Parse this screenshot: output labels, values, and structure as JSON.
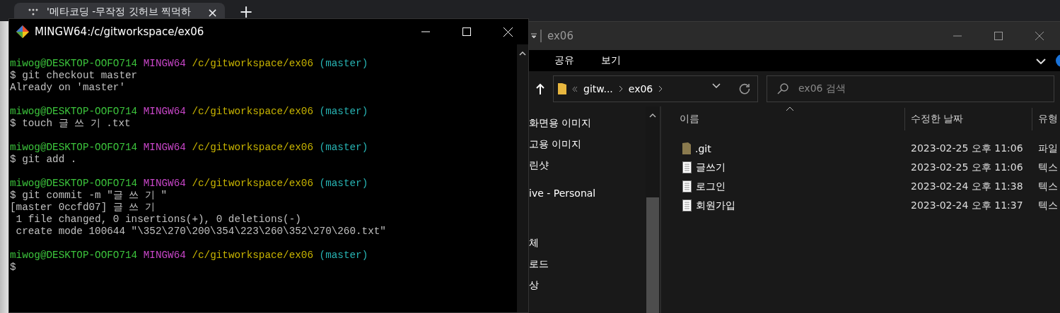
{
  "browser": {
    "tab_title": "'메타코딩 -무작정 깃허브 찍먹하",
    "tab_close": "×",
    "new_tab": "+"
  },
  "explorer": {
    "title": "ex06",
    "ribbon_tabs": [
      "공유",
      "보기"
    ],
    "breadcrumb": [
      "gitw...",
      "ex06"
    ],
    "search": {
      "placeholder": "ex06 검색"
    },
    "nav_items": [
      "화면용 이미지",
      "고용 이미지",
      "린샷",
      "ive - Personal",
      "체",
      "로드",
      "상"
    ],
    "columns": [
      "이름",
      "수정한 날짜",
      "유형"
    ],
    "files": [
      {
        "kind": "folder",
        "name": ".git",
        "modified": "2023-02-25 오후 11:06",
        "type": "파일"
      },
      {
        "kind": "text",
        "name": "글쓰기",
        "modified": "2023-02-25 오후 11:06",
        "type": "텍스"
      },
      {
        "kind": "text",
        "name": "로그인",
        "modified": "2023-02-24 오후 11:38",
        "type": "텍스"
      },
      {
        "kind": "text",
        "name": "회원가입",
        "modified": "2023-02-24 오후 11:37",
        "type": "텍스"
      }
    ]
  },
  "terminal": {
    "title": "MINGW64:/c/gitworkspace/ex06",
    "lines": [
      {
        "kind": "prompt",
        "user": "miwog@DESKTOP-OOFO714",
        "system": "MINGW64",
        "path": "/c/gitworkspace/ex06",
        "branch": "(master)"
      },
      {
        "kind": "output",
        "text": "$ git checkout master"
      },
      {
        "kind": "output",
        "text": "Already on 'master'"
      },
      {
        "kind": "blank"
      },
      {
        "kind": "prompt",
        "user": "miwog@DESKTOP-OOFO714",
        "system": "MINGW64",
        "path": "/c/gitworkspace/ex06",
        "branch": "(master)"
      },
      {
        "kind": "output",
        "text": "$ touch 글 쓰 기 .txt"
      },
      {
        "kind": "blank"
      },
      {
        "kind": "prompt",
        "user": "miwog@DESKTOP-OOFO714",
        "system": "MINGW64",
        "path": "/c/gitworkspace/ex06",
        "branch": "(master)"
      },
      {
        "kind": "output",
        "text": "$ git add ."
      },
      {
        "kind": "blank"
      },
      {
        "kind": "prompt",
        "user": "miwog@DESKTOP-OOFO714",
        "system": "MINGW64",
        "path": "/c/gitworkspace/ex06",
        "branch": "(master)"
      },
      {
        "kind": "output",
        "text": "$ git commit -m \"글 쓰 기 \""
      },
      {
        "kind": "output",
        "text": "[master 0ccfd07] 글 쓰 기"
      },
      {
        "kind": "output",
        "text": " 1 file changed, 0 insertions(+), 0 deletions(-)"
      },
      {
        "kind": "output",
        "text": " create mode 100644 \"\\352\\270\\200\\354\\223\\260\\352\\270\\260.txt\""
      },
      {
        "kind": "blank"
      },
      {
        "kind": "prompt",
        "user": "miwog@DESKTOP-OOFO714",
        "system": "MINGW64",
        "path": "/c/gitworkspace/ex06",
        "branch": "(master)"
      },
      {
        "kind": "output",
        "text": "$"
      }
    ]
  }
}
